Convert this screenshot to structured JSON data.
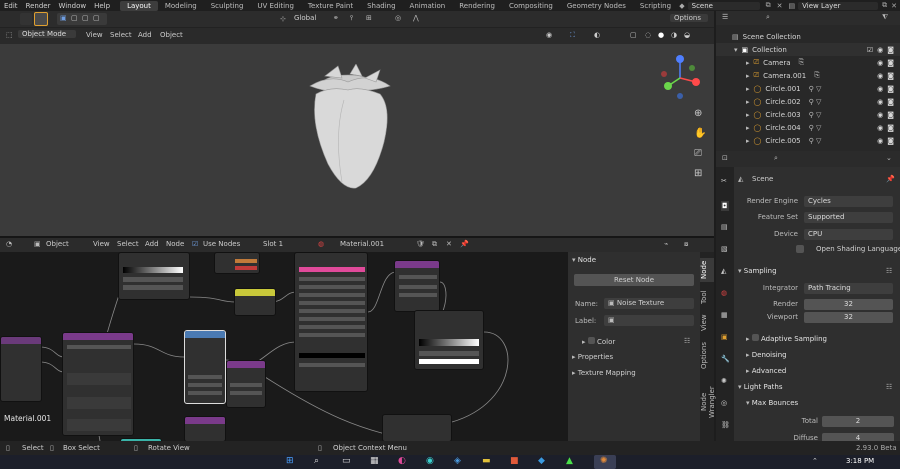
{
  "menu": {
    "items": [
      "Edit",
      "Render",
      "Window",
      "Help"
    ],
    "tabs": [
      "Layout",
      "Modeling",
      "Sculpting",
      "UV Editing",
      "Texture Paint",
      "Shading",
      "Animation",
      "Rendering",
      "Compositing",
      "Geometry Nodes",
      "Scripting"
    ],
    "active_tab": "Layout",
    "scene": "Scene",
    "view_layer": "View Layer"
  },
  "viewport": {
    "transform_orientation": "Global",
    "options": "Options",
    "mode": "Object Mode",
    "menus": [
      "View",
      "Select",
      "Add",
      "Object"
    ]
  },
  "outliner": {
    "root": "Scene Collection",
    "collection": "Collection",
    "items": [
      "Camera",
      "Camera.001",
      "Circle.001",
      "Circle.002",
      "Circle.003",
      "Circle.004",
      "Circle.005"
    ]
  },
  "properties": {
    "scene_label": "Scene",
    "render_engine_label": "Render Engine",
    "render_engine": "Cycles",
    "feature_set_label": "Feature Set",
    "feature_set": "Supported",
    "device_label": "Device",
    "device": "CPU",
    "osl_label": "Open Shading Language",
    "sampling": "Sampling",
    "integrator_label": "Integrator",
    "integrator": "Path Tracing",
    "render_label": "Render",
    "render_value": "32",
    "viewport_label": "Viewport",
    "viewport_value": "32",
    "adaptive_sampling": "Adaptive Sampling",
    "denoising": "Denoising",
    "advanced": "Advanced",
    "light_paths": "Light Paths",
    "max_bounces": "Max Bounces",
    "total_label": "Total",
    "total_value": "2",
    "diffuse_label": "Diffuse",
    "diffuse_value": "4"
  },
  "node_editor": {
    "type": "Object",
    "menus": [
      "View",
      "Select",
      "Add",
      "Node"
    ],
    "use_nodes": "Use Nodes",
    "slot": "Slot 1",
    "material": "Material.001",
    "material_label": "Material.001"
  },
  "node_panel": {
    "title": "Node",
    "reset": "Reset Node",
    "name_label": "Name:",
    "name_value": "Noise Texture",
    "label_label": "Label:",
    "color": "Color",
    "properties": "Properties",
    "texture_mapping": "Texture Mapping"
  },
  "node_tabs": [
    "Node",
    "Tool",
    "View",
    "Options",
    "Node Wrangler"
  ],
  "status": {
    "select": "Select",
    "box_select": "Box Select",
    "rotate": "Rotate View",
    "context": "Object Context Menu",
    "version": "2.93.0 Beta"
  },
  "taskbar": {
    "time": "3:18 PM"
  },
  "colors": {
    "accent": "#4772b3",
    "viewport_bg": "#3b3b3b",
    "node_bg": "#1a1a1a"
  }
}
